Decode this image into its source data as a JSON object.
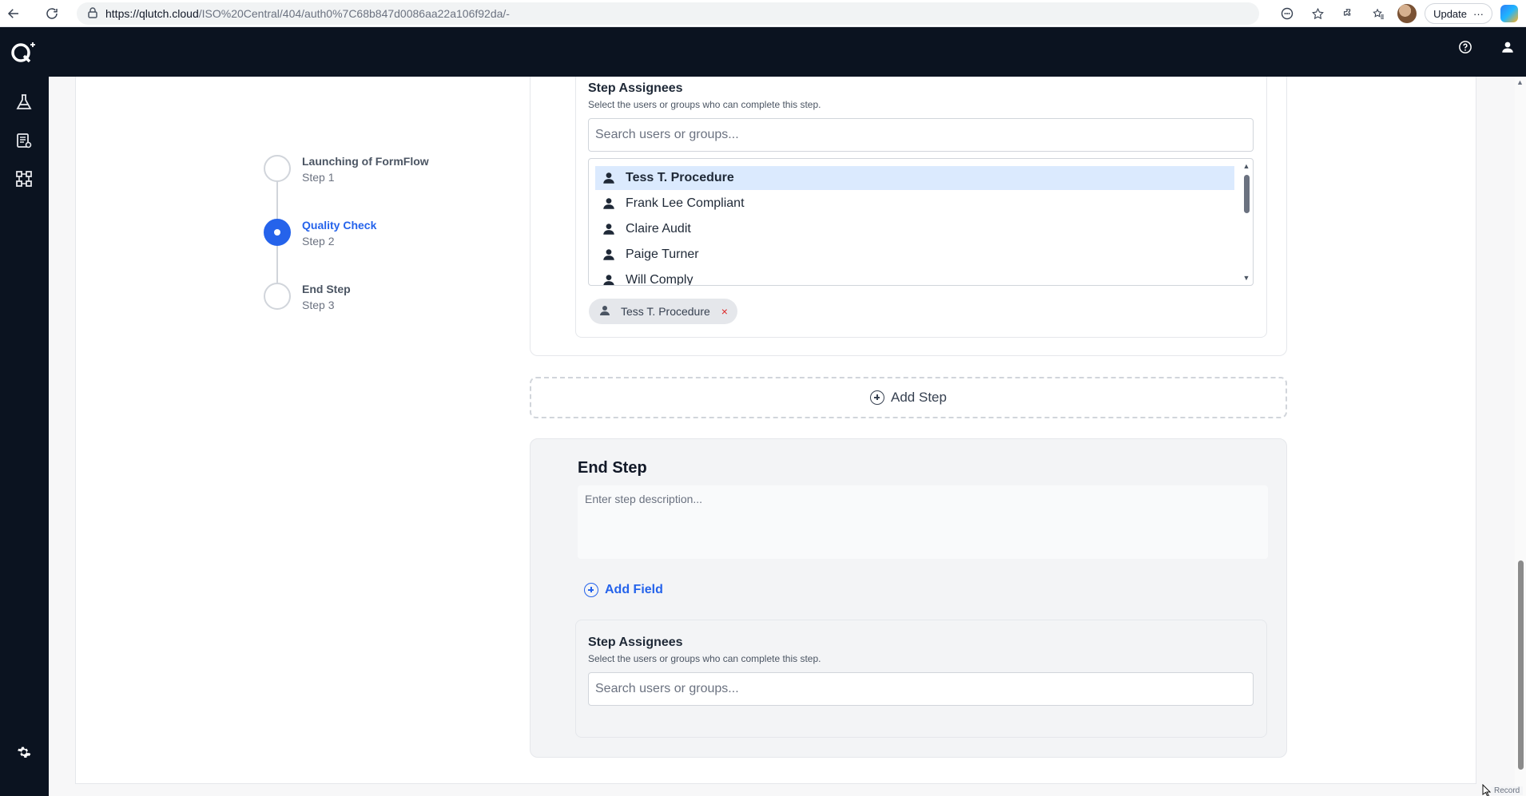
{
  "browser": {
    "url_host": "https://qlutch.cloud",
    "url_path": "/ISO%20Central/404/auth0%7C68b847d0086aa22a106f92da/-",
    "update_label": "Update",
    "more_label": "···"
  },
  "stepper": {
    "steps": [
      {
        "title": "Launching of FormFlow",
        "sub": "Step 1",
        "active": false
      },
      {
        "title": "Quality Check",
        "sub": "Step 2",
        "active": true
      },
      {
        "title": "End Step",
        "sub": "Step 3",
        "active": false
      }
    ]
  },
  "current_step": {
    "assignees_title": "Step Assignees",
    "assignees_desc": "Select the users or groups who can complete this step.",
    "search_placeholder": "Search users or groups...",
    "options": [
      "Tess T. Procedure",
      "Frank Lee Compliant",
      "Claire Audit",
      "Paige Turner",
      "Will Comply"
    ],
    "selected_option": "Tess T. Procedure",
    "chips": [
      "Tess T. Procedure"
    ],
    "chip_remove": "×"
  },
  "add_step_label": "Add Step",
  "end_step": {
    "title": "End Step",
    "description_placeholder": "Enter step description...",
    "add_field_label": "Add Field",
    "assignees_title": "Step Assignees",
    "assignees_desc": "Select the users or groups who can complete this step.",
    "search_placeholder": "Search users or groups..."
  },
  "record_label": "Record",
  "colors": {
    "accent": "#2563eb",
    "header_bg": "#0b1320",
    "selected_bg": "#dbeafe",
    "chip_remove": "#dc2626"
  }
}
